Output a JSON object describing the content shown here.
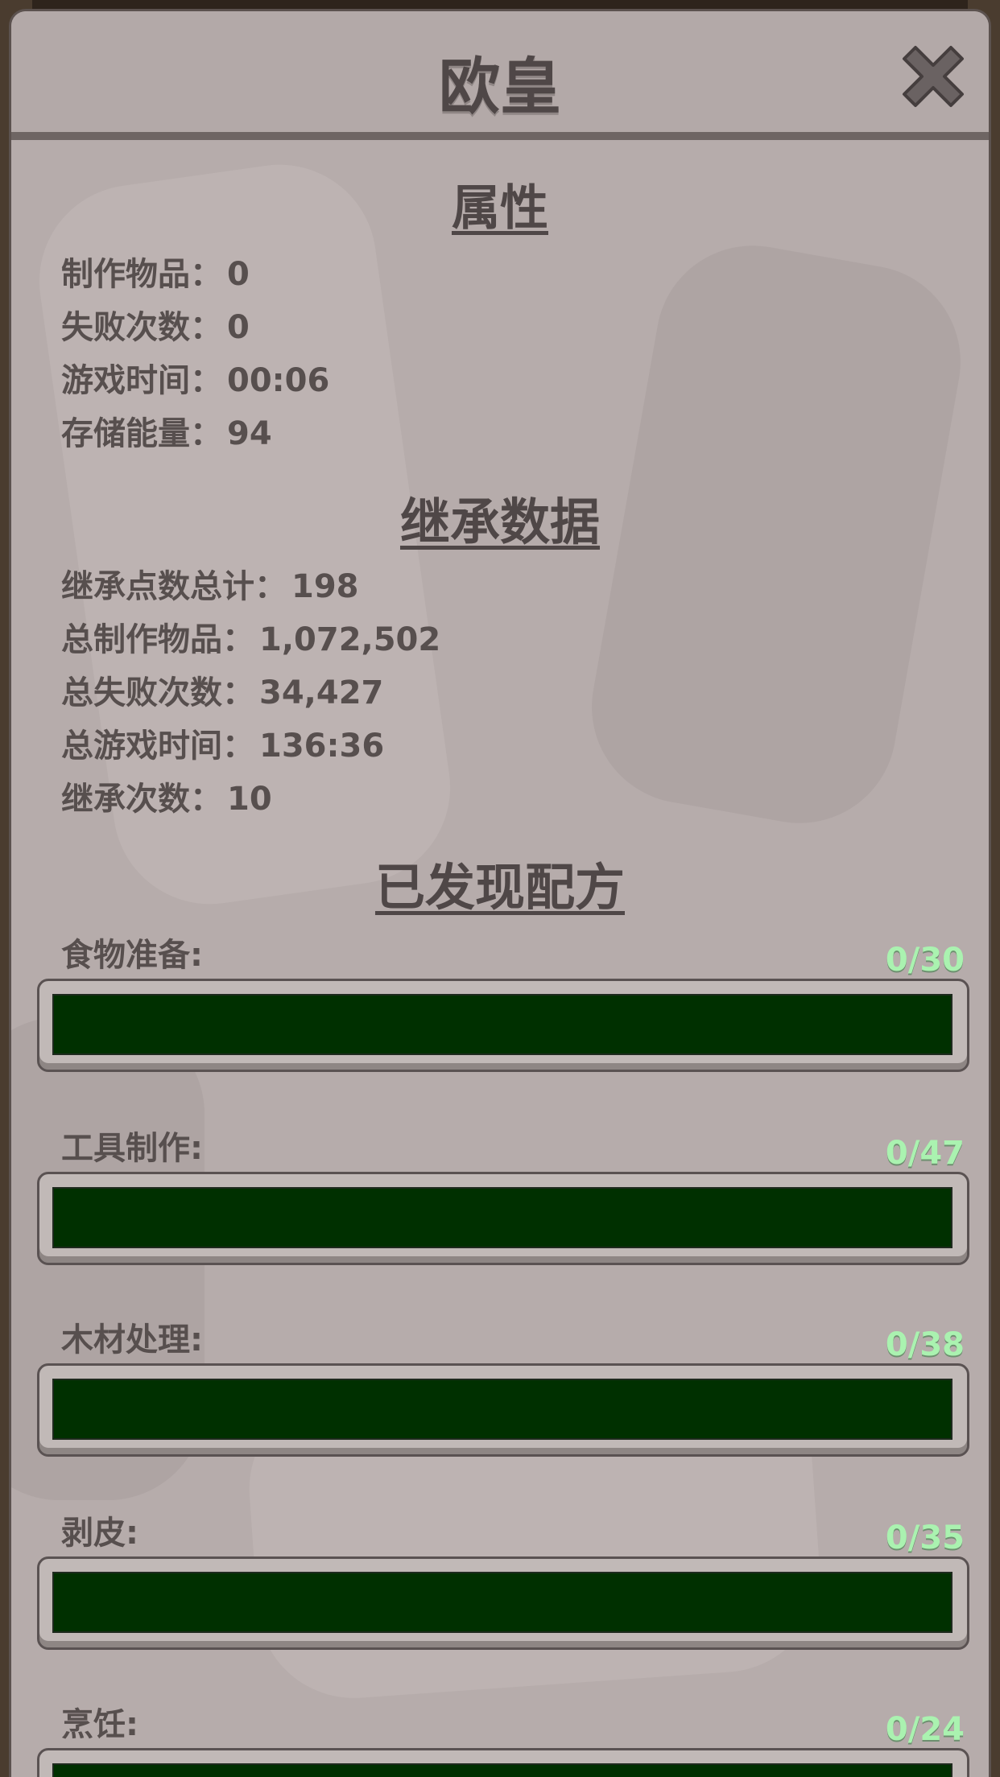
{
  "dialog": {
    "title": "欧皇",
    "close_icon": "close-x-icon"
  },
  "attributes": {
    "heading": "属性",
    "items": [
      {
        "label": "制作物品：",
        "value": "0"
      },
      {
        "label": "失败次数：",
        "value": "0"
      },
      {
        "label": "游戏时间：",
        "value": "00:06"
      },
      {
        "label": "存储能量：",
        "value": "94"
      }
    ]
  },
  "legacy": {
    "heading": "继承数据",
    "items": [
      {
        "label": "继承点数总计：",
        "value": "198"
      },
      {
        "label": "总制作物品：",
        "value": "1,072,502"
      },
      {
        "label": "总失败次数：",
        "value": "34,427"
      },
      {
        "label": "总游戏时间：",
        "value": "136:36"
      },
      {
        "label": "继承次数：",
        "value": "10"
      }
    ]
  },
  "recipes": {
    "heading": "已发现配方",
    "categories": [
      {
        "label": "食物准备:",
        "count": "0/30",
        "progress": 0
      },
      {
        "label": "工具制作:",
        "count": "0/47",
        "progress": 0
      },
      {
        "label": "木材处理:",
        "count": "0/38",
        "progress": 0
      },
      {
        "label": "剥皮:",
        "count": "0/35",
        "progress": 0
      },
      {
        "label": "烹饪:",
        "count": "0/24",
        "progress": 0
      }
    ]
  },
  "colors": {
    "panel": "#b6acab",
    "text": "#574f4e",
    "count_text": "#aaf2b0",
    "bar_track": "#003000"
  }
}
